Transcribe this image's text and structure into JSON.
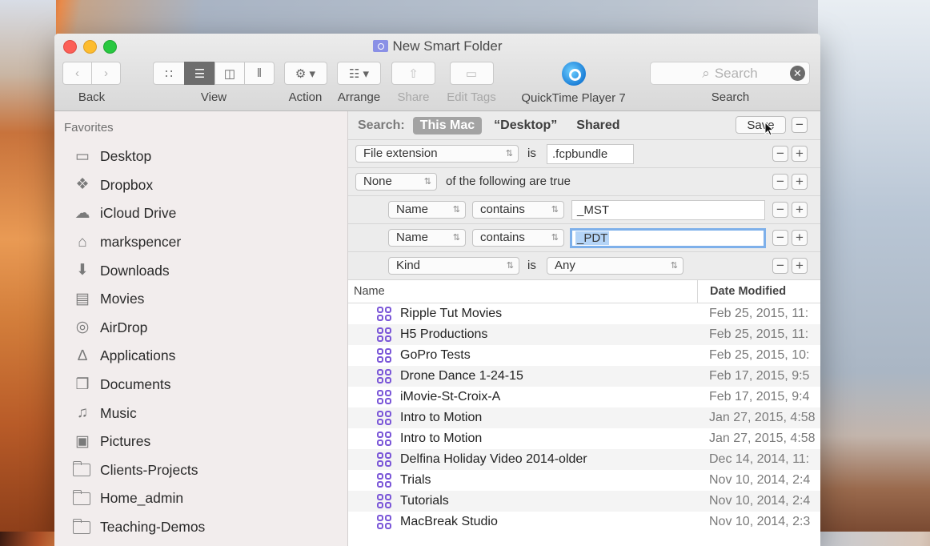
{
  "window": {
    "title": "New Smart Folder"
  },
  "toolbar": {
    "back_label": "Back",
    "view_label": "View",
    "action_label": "Action",
    "arrange_label": "Arrange",
    "share_label": "Share",
    "edit_tags_label": "Edit Tags",
    "quicktime_label": "QuickTime Player 7",
    "search_label": "Search",
    "search_placeholder": "Search"
  },
  "sidebar": {
    "heading": "Favorites",
    "items": [
      {
        "label": "Desktop",
        "icon": "desktop-icon"
      },
      {
        "label": "Dropbox",
        "icon": "dropbox-icon"
      },
      {
        "label": "iCloud Drive",
        "icon": "cloud-icon"
      },
      {
        "label": "markspencer",
        "icon": "home-icon"
      },
      {
        "label": "Downloads",
        "icon": "downloads-icon"
      },
      {
        "label": "Movies",
        "icon": "film-icon"
      },
      {
        "label": "AirDrop",
        "icon": "airdrop-icon"
      },
      {
        "label": "Applications",
        "icon": "applications-icon"
      },
      {
        "label": "Documents",
        "icon": "documents-icon"
      },
      {
        "label": "Music",
        "icon": "music-icon"
      },
      {
        "label": "Pictures",
        "icon": "camera-icon"
      },
      {
        "label": "Clients-Projects",
        "icon": "folder-icon"
      },
      {
        "label": "Home_admin",
        "icon": "folder-icon"
      },
      {
        "label": "Teaching-Demos",
        "icon": "folder-icon"
      }
    ]
  },
  "scope": {
    "label": "Search:",
    "options": [
      "This Mac",
      "“Desktop”",
      "Shared"
    ],
    "selected": "This Mac",
    "save_label": "Save"
  },
  "criteria": {
    "row1": {
      "attribute": "File extension",
      "op": "is",
      "value": ".fcpbundle"
    },
    "row2": {
      "attribute": "None",
      "text": "of the following are true"
    },
    "row3": {
      "attribute": "Name",
      "op": "contains",
      "value": "_MST"
    },
    "row4": {
      "attribute": "Name",
      "op": "contains",
      "value": "_PDT"
    },
    "row5": {
      "attribute": "Kind",
      "op": "is",
      "value": "Any"
    }
  },
  "list": {
    "col_name": "Name",
    "col_date": "Date Modified",
    "rows": [
      {
        "name": "Ripple Tut Movies",
        "date": "Feb 25, 2015, 11:"
      },
      {
        "name": "H5 Productions",
        "date": "Feb 25, 2015, 11:"
      },
      {
        "name": "GoPro Tests",
        "date": "Feb 25, 2015, 10:"
      },
      {
        "name": "Drone Dance 1-24-15",
        "date": "Feb 17, 2015, 9:5"
      },
      {
        "name": "iMovie-St-Croix-A",
        "date": "Feb 17, 2015, 9:4"
      },
      {
        "name": "Intro to Motion",
        "date": "Jan 27, 2015, 4:58"
      },
      {
        "name": "Intro to Motion",
        "date": "Jan 27, 2015, 4:58"
      },
      {
        "name": "Delfina Holiday Video 2014-older",
        "date": "Dec 14, 2014, 11:"
      },
      {
        "name": "Trials",
        "date": "Nov 10, 2014, 2:4"
      },
      {
        "name": "Tutorials",
        "date": "Nov 10, 2014, 2:4"
      },
      {
        "name": "MacBreak Studio",
        "date": "Nov 10, 2014, 2:3"
      }
    ]
  }
}
